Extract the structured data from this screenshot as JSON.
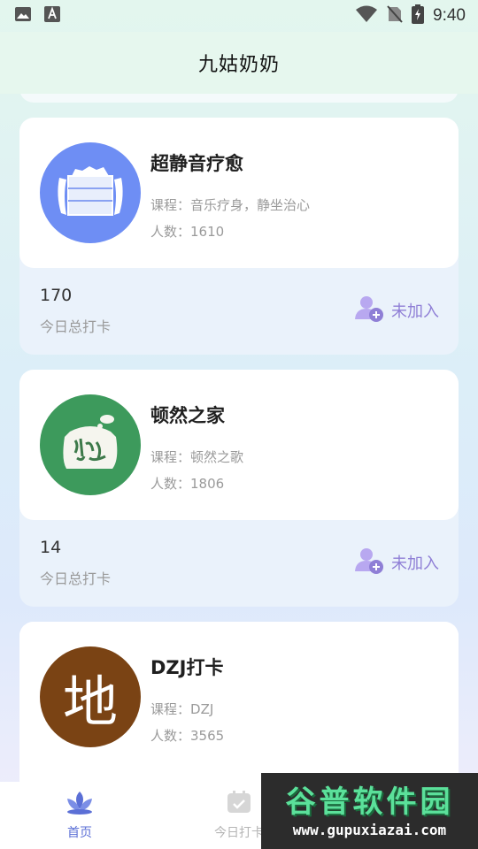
{
  "status_bar": {
    "time": "9:40",
    "icons": [
      "image-icon",
      "text-a-icon",
      "wifi-icon",
      "no-sim-icon",
      "battery-charging-icon"
    ]
  },
  "header": {
    "title": "九姑奶奶"
  },
  "groups": [
    {
      "name": "超静音疗愈",
      "course_label": "课程：",
      "course": "音乐疗身，静坐治心",
      "members_label": "人数：",
      "members": "1610",
      "checkin_today": "170",
      "checkin_label": "今日总打卡",
      "join_label": "未加入",
      "avatar_color": "#6e8ef4"
    },
    {
      "name": "顿然之家",
      "course_label": "课程：",
      "course": "顿然之歌",
      "members_label": "人数：",
      "members": "1806",
      "checkin_today": "14",
      "checkin_label": "今日总打卡",
      "join_label": "未加入",
      "avatar_color": "#3d9a5c"
    },
    {
      "name": "DZJ打卡",
      "course_label": "课程：",
      "course": "DZJ",
      "members_label": "人数：",
      "members": "3565",
      "avatar_text": "地",
      "avatar_color": "#7a4314"
    }
  ],
  "tabbar": {
    "tabs": [
      {
        "label": "首页",
        "icon": "lotus-icon",
        "active": true
      },
      {
        "label": "今日打卡",
        "icon": "calendar-check-icon",
        "active": false
      }
    ]
  },
  "watermark": {
    "title": "谷普软件园",
    "url": "www.gupuxiazai.com"
  },
  "colors": {
    "accent": "#5b6fd6",
    "join": "#8f7fd6"
  }
}
